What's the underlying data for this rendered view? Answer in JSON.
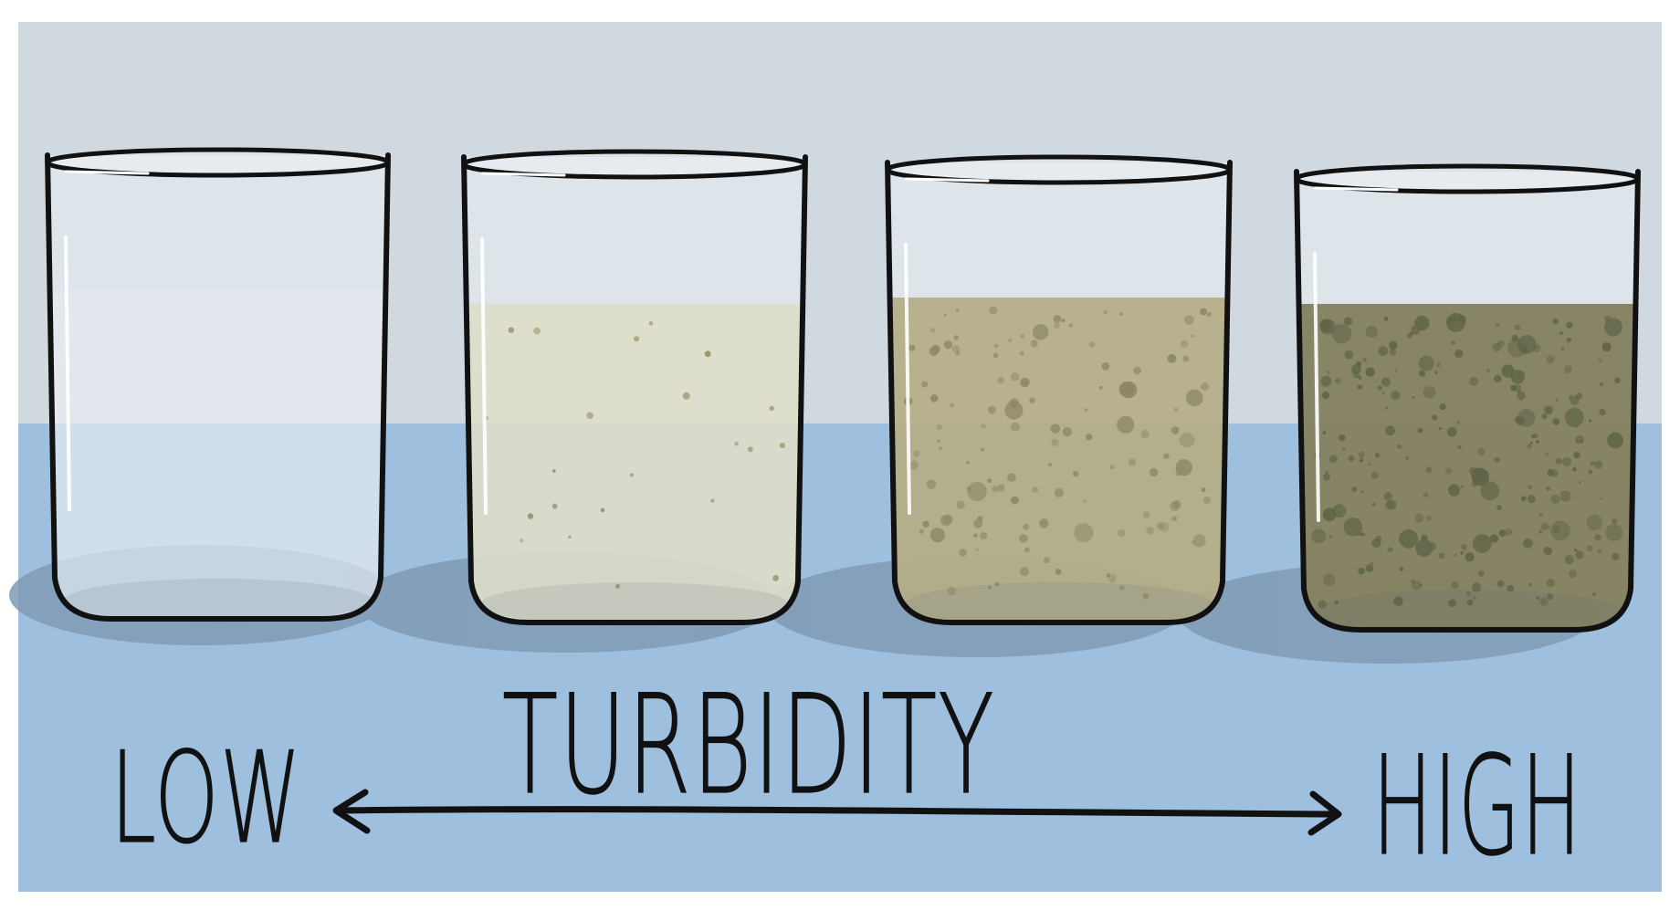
{
  "labels": {
    "title": "TURBIDITY",
    "low": "LOW",
    "high": "HIGH"
  },
  "colors": {
    "wall": "#d0d9e0",
    "table": "#9ebfde",
    "frame": "#ffffff",
    "outline": "#111111",
    "shadow": "#7f9ab4"
  },
  "beakers": [
    {
      "name": "beaker-clear",
      "water": "rgba(232,238,244,0.45)",
      "particles": "none"
    },
    {
      "name": "beaker-slightly-turbid",
      "water": "rgba(222,220,196,0.80)",
      "particles": "few"
    },
    {
      "name": "beaker-turbid",
      "water": "rgba(178,170,128,0.88)",
      "particles": "many"
    },
    {
      "name": "beaker-very-turbid",
      "water": "rgba(132,128,96,0.96)",
      "particles": "dense"
    }
  ]
}
